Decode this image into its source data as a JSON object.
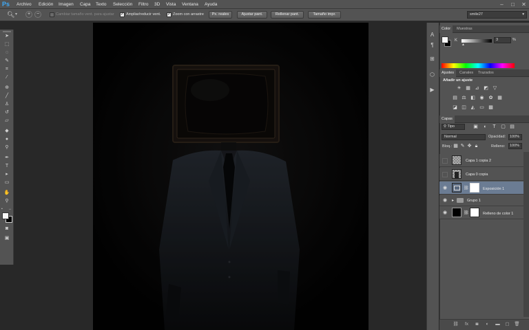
{
  "app": {
    "logo": "Ps"
  },
  "menu": [
    "Archivo",
    "Edición",
    "Imagen",
    "Capa",
    "Texto",
    "Selección",
    "Filtro",
    "3D",
    "Vista",
    "Ventana",
    "Ayuda"
  ],
  "window_controls": {
    "minimize": "–",
    "maximize": "□",
    "close": "✕"
  },
  "options": {
    "resize_label": "Cambiar tamaño vent. para ajustar",
    "zoom_all_label": "Ampliar/reducir vent.",
    "scrubby_label": "Zoom con arrastre",
    "btn_actual": "Px. reales",
    "btn_fit": "Ajustar pant.",
    "btn_fill": "Rellenar pant.",
    "btn_print": "Tamaño impr.",
    "workspace": "smile27"
  },
  "color_panel": {
    "tabs": [
      "Color",
      "Muestras"
    ],
    "channel": "K",
    "value": "3",
    "unit": "%"
  },
  "adjust_panel": {
    "tabs": [
      "Ajustes",
      "Canales",
      "Trazados"
    ],
    "title": "Añadir un ajuste"
  },
  "layers_panel": {
    "tab": "Capas",
    "filter": "Tipo",
    "blend_mode": "Normal",
    "opacity_label": "Opacidad:",
    "opacity": "100%",
    "lock_label": "Bloq.:",
    "fill_label": "Relleno:",
    "fill": "100%",
    "layers": [
      {
        "name": "Capa 1 copia 2",
        "selected": false
      },
      {
        "name": "Capa 0 copia",
        "selected": false
      },
      {
        "name": "Exposición 1",
        "selected": true
      },
      {
        "name": "Grupo 1",
        "selected": false
      },
      {
        "name": "Relleno de color 1",
        "selected": false
      }
    ]
  },
  "colors": {
    "accent": "#3fa9f5",
    "selection": "#6b7c93",
    "canvas": "#020202"
  }
}
